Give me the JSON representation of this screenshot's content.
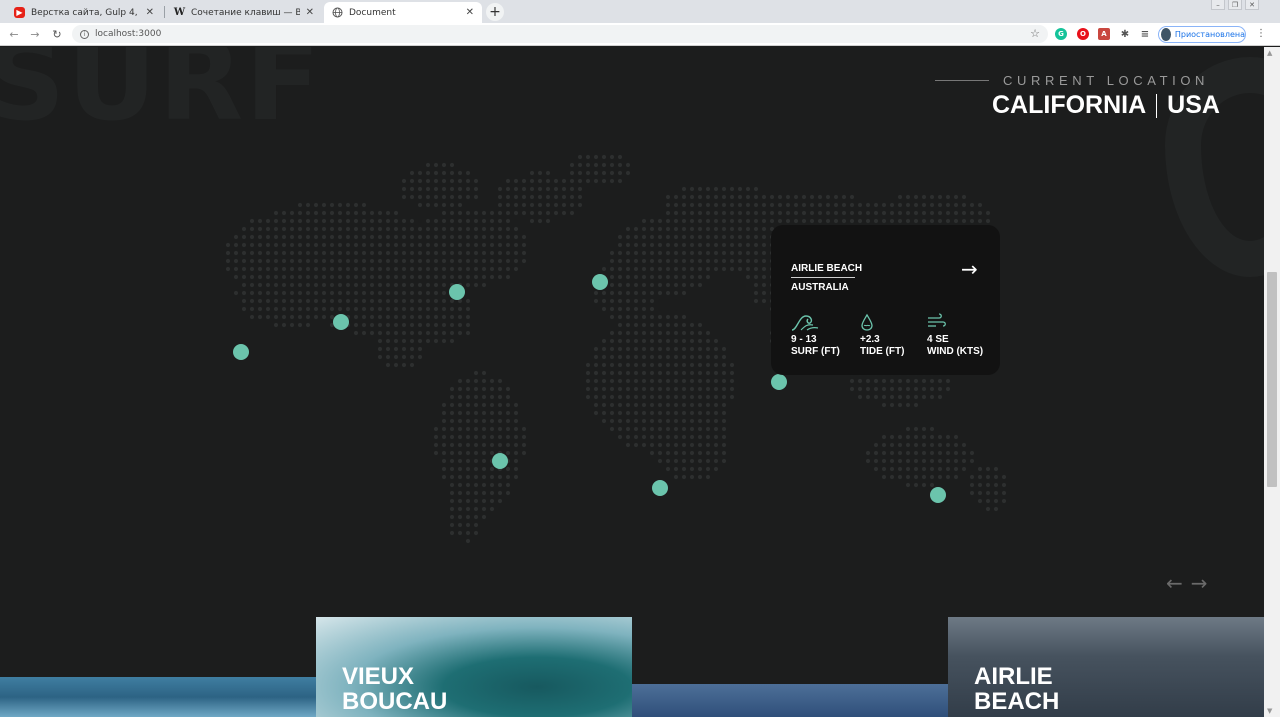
{
  "browser": {
    "tabs": [
      {
        "title": "Верстка сайта, Gulp 4, препроц",
        "favicon": "youtube-icon",
        "active": false
      },
      {
        "title": "Сочетание клавиш — Википеди",
        "favicon": "wikipedia-icon",
        "active": false
      },
      {
        "title": "Document",
        "favicon": "globe-icon",
        "active": true
      }
    ],
    "url": "localhost:3000",
    "profile_label": "Приостановлена"
  },
  "page": {
    "bg_word": "SURF",
    "current_location": {
      "label": "CURRENT LOCATION",
      "region": "CALIFORNIA",
      "country": "USA"
    },
    "card": {
      "place": "AIRLIE BEACH",
      "country": "AUSTRALIA",
      "stats": [
        {
          "icon": "wave-icon",
          "value": "9 - 13",
          "label": "SURF (FT)"
        },
        {
          "icon": "drop-icon",
          "value": "+2.3",
          "label": "TIDE (FT)"
        },
        {
          "icon": "wind-icon",
          "value": "4 SE",
          "label": "WIND (KTS)"
        }
      ]
    },
    "thumbnails": [
      {
        "label_line1": "VIEUX",
        "label_line2": "BOUCAU"
      },
      {
        "label_line1": "AIRLIE",
        "label_line2": "BEACH"
      }
    ],
    "colors": {
      "accent": "#6bc4ac",
      "background": "#1c1d1d",
      "card": "#121212"
    }
  }
}
